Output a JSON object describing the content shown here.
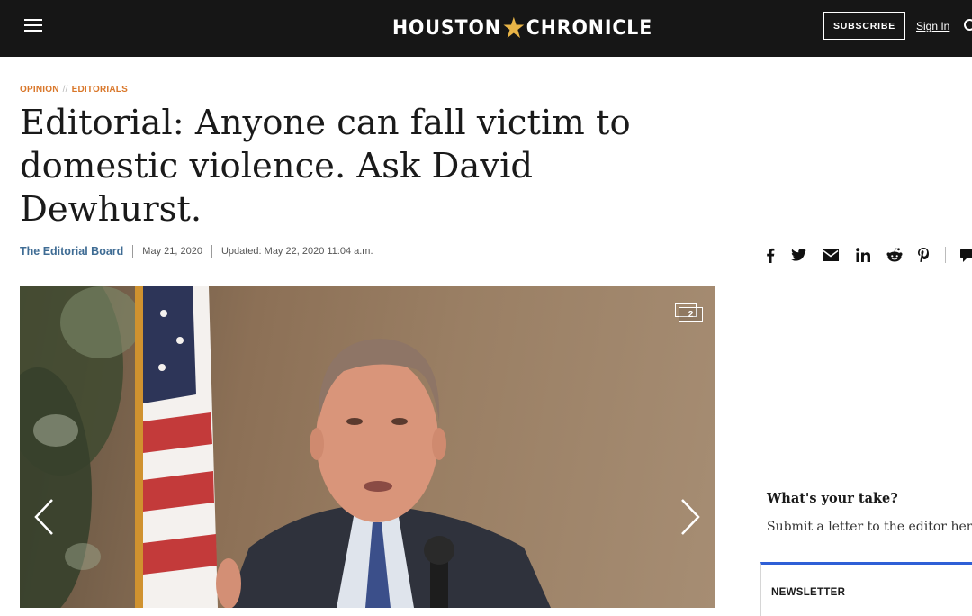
{
  "header": {
    "logo_left": "HOUSTON",
    "logo_right": "CHRONICLE",
    "subscribe_label": "SUBSCRIBE",
    "signin_label": "Sign In"
  },
  "breadcrumb": {
    "section": "OPINION",
    "separator": "//",
    "subsection": "EDITORIALS"
  },
  "article": {
    "headline": "Editorial: Anyone can fall victim to domestic violence. Ask David Dewhurst.",
    "author": "The Editorial Board",
    "published": "May 21, 2020",
    "updated": "Updated: May 22, 2020 11:04 a.m."
  },
  "share_icons": [
    "facebook-icon",
    "twitter-icon",
    "email-icon",
    "linkedin-icon",
    "reddit-icon",
    "pinterest-icon",
    "comment-icon"
  ],
  "gallery": {
    "count": "2"
  },
  "sidebar": {
    "take_heading": "What's your take?",
    "take_link": "Submit a letter to the editor here",
    "newsletter_label": "NEWSLETTER"
  },
  "colors": {
    "topbar": "#161616",
    "accent_orange": "#d9772a",
    "author_blue": "#3f6c94",
    "logo_star": "#e8b447",
    "newsletter_border": "#2f5fd6"
  }
}
